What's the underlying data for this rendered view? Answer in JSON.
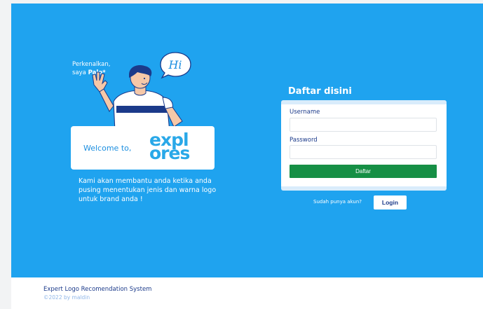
{
  "intro": {
    "line1": "Perkenalkan,",
    "line2_prefix": "saya ",
    "line2_name": "Palo*"
  },
  "speech_bubble": {
    "text": "Hi"
  },
  "welcome": {
    "text": "Welcome to,",
    "logo_line1": "expl",
    "logo_line2": "ores"
  },
  "description": "Kami akan membantu anda ketika anda pusing menentukan jenis dan warna logo untuk brand anda !",
  "form": {
    "title": "Daftar disini",
    "username_label": "Username",
    "password_label": "Password",
    "submit_label": "Daftar"
  },
  "login": {
    "question": "Sudah punya akun?",
    "button_label": "Login"
  },
  "footer": {
    "title": "Expert Logo Recomendation System",
    "copyright": "©2022 by maldin"
  },
  "colors": {
    "hero_bg": "#1fa3ef",
    "button_green": "#168f45",
    "text_navy": "#1b3a8a"
  }
}
